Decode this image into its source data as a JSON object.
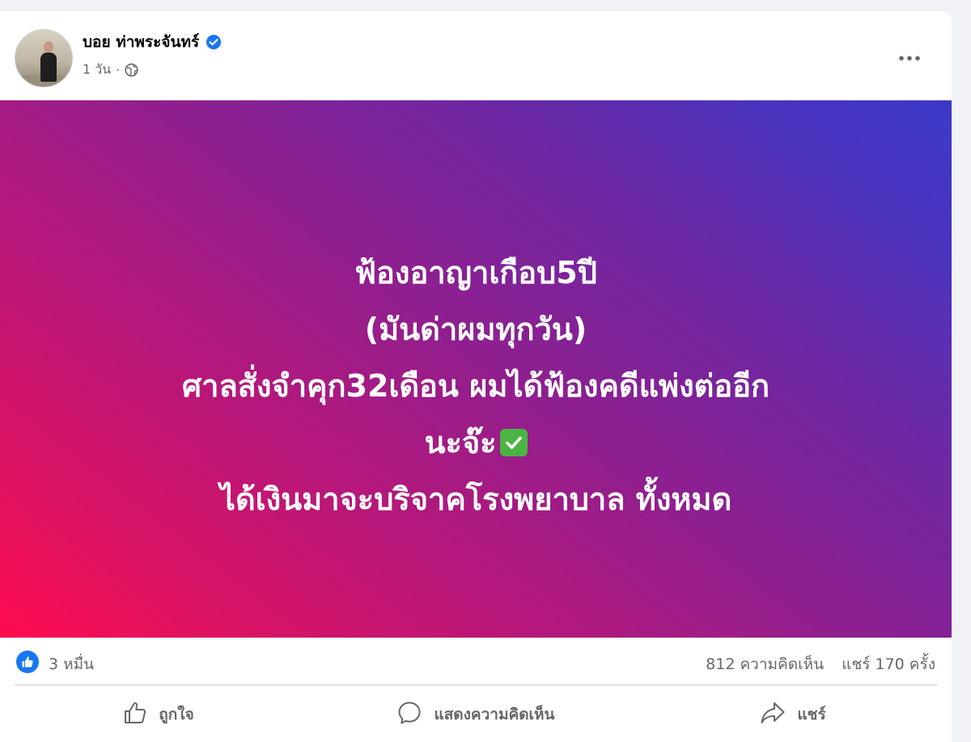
{
  "post": {
    "author": {
      "name": "บอย ท่าพระจันทร์",
      "verified": true
    },
    "meta": {
      "time": "1 วัน",
      "separator": "·",
      "privacy_icon": "globe-icon"
    },
    "more_icon": "more-dots-icon",
    "background": {
      "start": "#ff0a4e",
      "end": "#3b39c8"
    },
    "text_lines": [
      "ฟ้องอาญาเกือบ5ปี",
      "(มันด่าผมทุกวัน)",
      "ศาลสั่งจำคุก32เดือน ผมได้ฟ้องคดีแพ่งต่ออีก",
      "นะจ๊ะ",
      "ได้เงินมาจะบริจาคโรงพยาบาล ทั้งหมด"
    ],
    "emoji": "check-mark-icon"
  },
  "stats": {
    "reactions": "3 หมื่น",
    "comments": "812 ความคิดเห็น",
    "shares": "แชร์ 170 ครั้ง"
  },
  "actions": {
    "like": "ถูกใจ",
    "comment": "แสดงความคิดเห็น",
    "share": "แชร์"
  },
  "colors": {
    "accent": "#1877f2",
    "muted": "#65676b"
  }
}
